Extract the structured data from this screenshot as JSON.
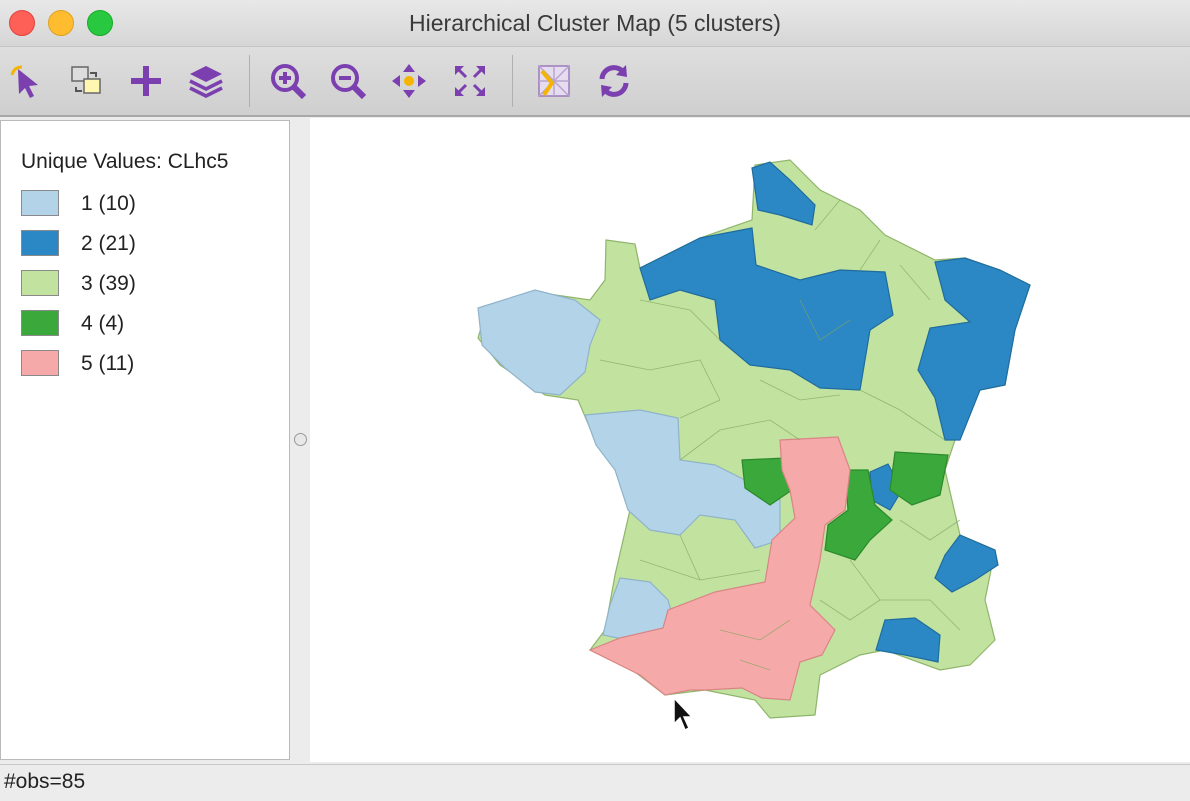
{
  "window": {
    "title": "Hierarchical Cluster Map (5 clusters)"
  },
  "toolbar": {
    "icons": [
      "select-arrow-icon",
      "map-swap-icon",
      "plus-icon",
      "layers-icon",
      "zoom-in-icon",
      "zoom-out-icon",
      "pan-icon",
      "fit-extent-icon",
      "basemap-icon",
      "refresh-icon"
    ],
    "icon_color": "#7b3fb0",
    "accent_color": "#f4b400"
  },
  "legend": {
    "title": "Unique Values: CLhc5",
    "items": [
      {
        "label": "1 (10)",
        "color": "#b3d4e8"
      },
      {
        "label": "2 (21)",
        "color": "#2b88c4"
      },
      {
        "label": "3 (39)",
        "color": "#c2e2a0"
      },
      {
        "label": "4 (4)",
        "color": "#3aa83a"
      },
      {
        "label": "5 (11)",
        "color": "#f6a9a9"
      }
    ]
  },
  "status": {
    "text": "#obs=85"
  }
}
